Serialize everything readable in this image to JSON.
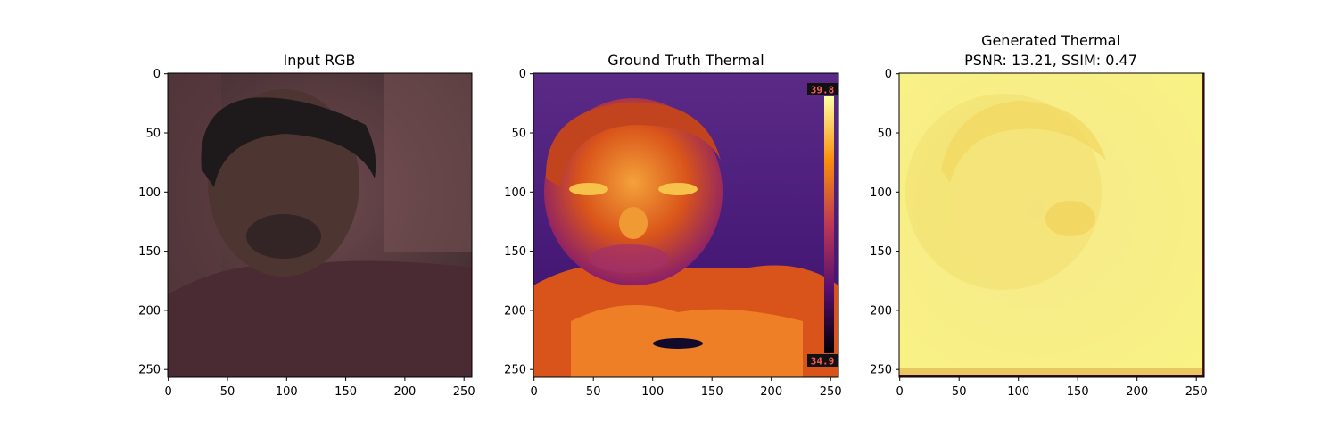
{
  "figure": {
    "panels": [
      {
        "title_lines": [
          "Input RGB"
        ],
        "description_hidden": "photo",
        "x_ticks": [
          "0",
          "50",
          "100",
          "150",
          "200",
          "250"
        ],
        "y_ticks": [
          "0",
          "50",
          "100",
          "150",
          "200",
          "250"
        ]
      },
      {
        "title_lines": [
          "Ground Truth Thermal"
        ],
        "colorbar": {
          "max": "39.8",
          "min": "34.9"
        },
        "x_ticks": [
          "0",
          "50",
          "100",
          "150",
          "200",
          "250"
        ],
        "y_ticks": [
          "0",
          "50",
          "100",
          "150",
          "200",
          "250"
        ]
      },
      {
        "title_lines": [
          "Generated Thermal",
          "PSNR: 13.21, SSIM: 0.47"
        ],
        "x_ticks": [
          "0",
          "50",
          "100",
          "150",
          "200",
          "250"
        ],
        "y_ticks": [
          "0",
          "50",
          "100",
          "150",
          "200",
          "250"
        ]
      }
    ]
  }
}
